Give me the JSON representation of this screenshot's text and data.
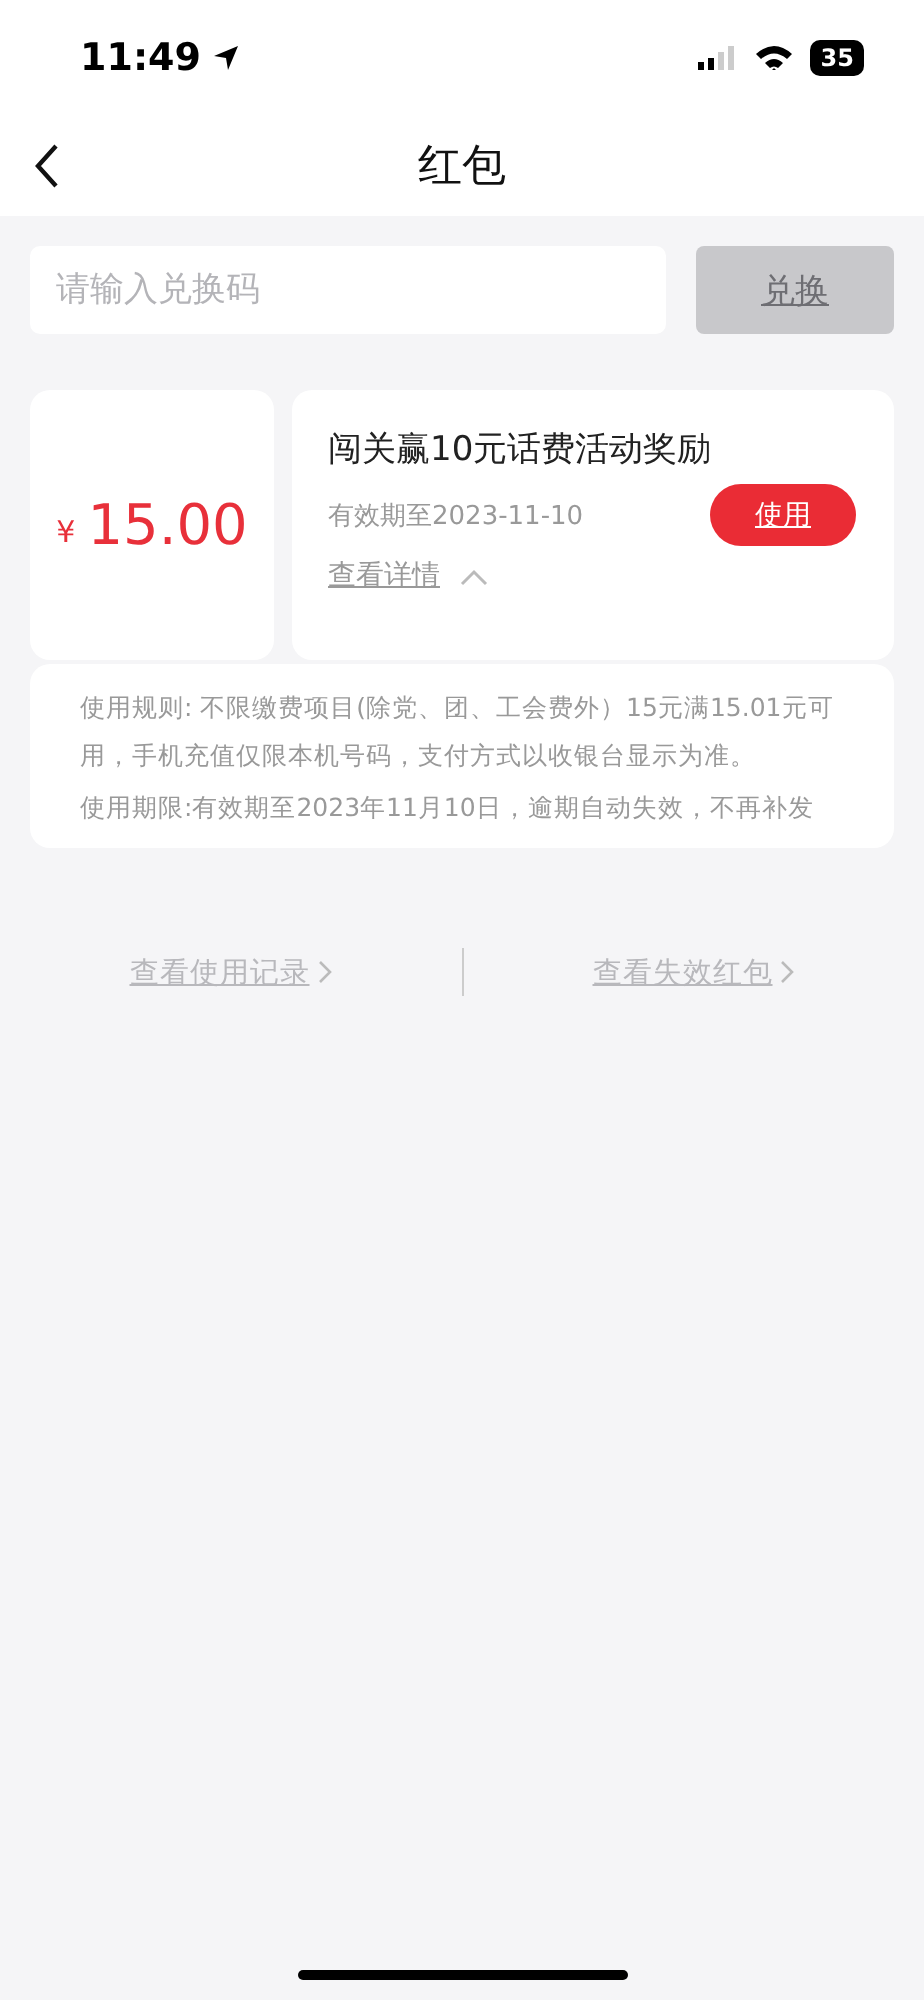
{
  "status_bar": {
    "time": "11:49",
    "battery": "35"
  },
  "nav": {
    "title": "红包"
  },
  "redeem": {
    "placeholder": "请输入兑换码",
    "button": "兑换",
    "button_disabled": true
  },
  "coupon": {
    "currency": "¥",
    "amount": "15.00",
    "title": "闯关赢10元话费活动奖励",
    "validity": "有效期至2023-11-10",
    "use_button": "使用",
    "details_link": "查看详情",
    "expanded": true,
    "rules": [
      "使用规则: 不限缴费项目(除党、团、工会费外）15元满15.01元可用，手机充值仅限本机号码，支付方式以收银台显示为准。",
      "使用期限:有效期至2023年11月10日，逾期自动失效，不再补发"
    ]
  },
  "links": [
    "查看使用记录",
    "查看失效红包"
  ]
}
